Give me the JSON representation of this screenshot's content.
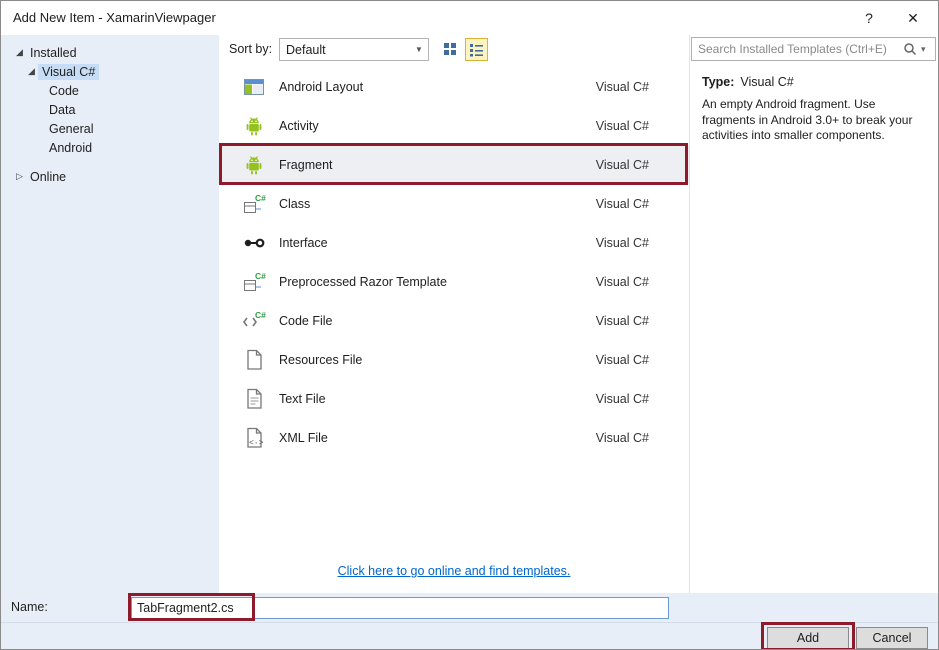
{
  "window": {
    "title": "Add New Item - XamarinViewpager"
  },
  "titlebar_icons": {
    "help": "?",
    "close": "✕"
  },
  "icons": {
    "expanded": "◢",
    "collapsed": "▷",
    "combo_arrow": "▼",
    "search_dropdown": "▾"
  },
  "sidebar": {
    "items": [
      {
        "label": "Installed"
      },
      {
        "label": "Visual C#"
      },
      {
        "label": "Code"
      },
      {
        "label": "Data"
      },
      {
        "label": "General"
      },
      {
        "label": "Android"
      },
      {
        "label": "Online"
      }
    ]
  },
  "toolbar": {
    "sort_label": "Sort by:",
    "sort_value": "Default"
  },
  "search": {
    "placeholder": "Search Installed Templates (Ctrl+E)"
  },
  "templates": [
    {
      "name": "Android Layout",
      "language": "Visual C#"
    },
    {
      "name": "Activity",
      "language": "Visual C#"
    },
    {
      "name": "Fragment",
      "language": "Visual C#"
    },
    {
      "name": "Class",
      "language": "Visual C#"
    },
    {
      "name": "Interface",
      "language": "Visual C#"
    },
    {
      "name": "Preprocessed Razor Template",
      "language": "Visual C#"
    },
    {
      "name": "Code File",
      "language": "Visual C#"
    },
    {
      "name": "Resources File",
      "language": "Visual C#"
    },
    {
      "name": "Text File",
      "language": "Visual C#"
    },
    {
      "name": "XML File",
      "language": "Visual C#"
    }
  ],
  "details": {
    "type_label": "Type:",
    "type_value": "Visual C#",
    "description": "An empty Android fragment.  Use fragments in Android 3.0+ to break your activities into smaller components."
  },
  "footer_link": "Click here to go online and find templates.",
  "name_row": {
    "label": "Name:",
    "value": "TabFragment2.cs"
  },
  "buttons": {
    "add": "Add",
    "cancel": "Cancel"
  },
  "colors": {
    "annotation": "#8e1b2c",
    "selection": "#c6ddf5",
    "sidebar_bg": "#e8eef7",
    "link": "#0066cc",
    "android_green": "#94c11f",
    "view_selected_bg": "#fdf3be",
    "view_selected_border": "#d9b23c"
  }
}
